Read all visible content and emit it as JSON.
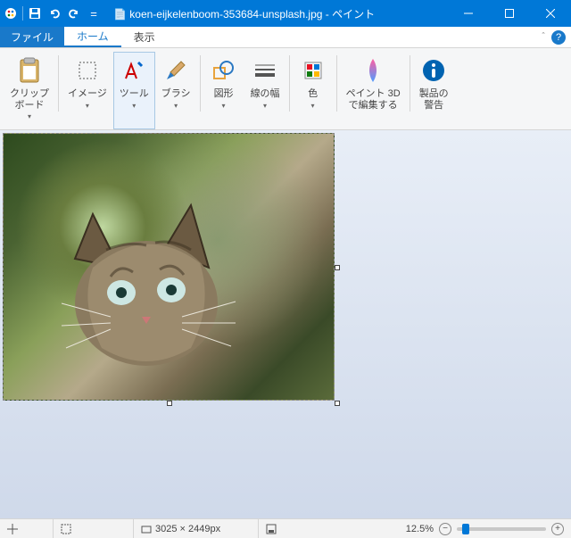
{
  "window": {
    "filename": "koen-eijkelenboom-353684-unsplash.jpg",
    "app_name": "ペイント",
    "title_sep": " - "
  },
  "menus": {
    "file": "ファイル",
    "home": "ホーム",
    "view": "表示"
  },
  "ribbon": {
    "clipboard": "クリップ\nボード",
    "image": "イメージ",
    "tool": "ツール",
    "brush": "ブラシ",
    "shapes": "図形",
    "stroke": "線の幅",
    "color": "色",
    "paint3d": "ペイント 3D\nで編集する",
    "warnings": "製品の\n警告"
  },
  "status": {
    "dimensions": "3025 × 2449px",
    "zoom": "12.5%"
  },
  "colors": {
    "accent": "#0078d7"
  }
}
